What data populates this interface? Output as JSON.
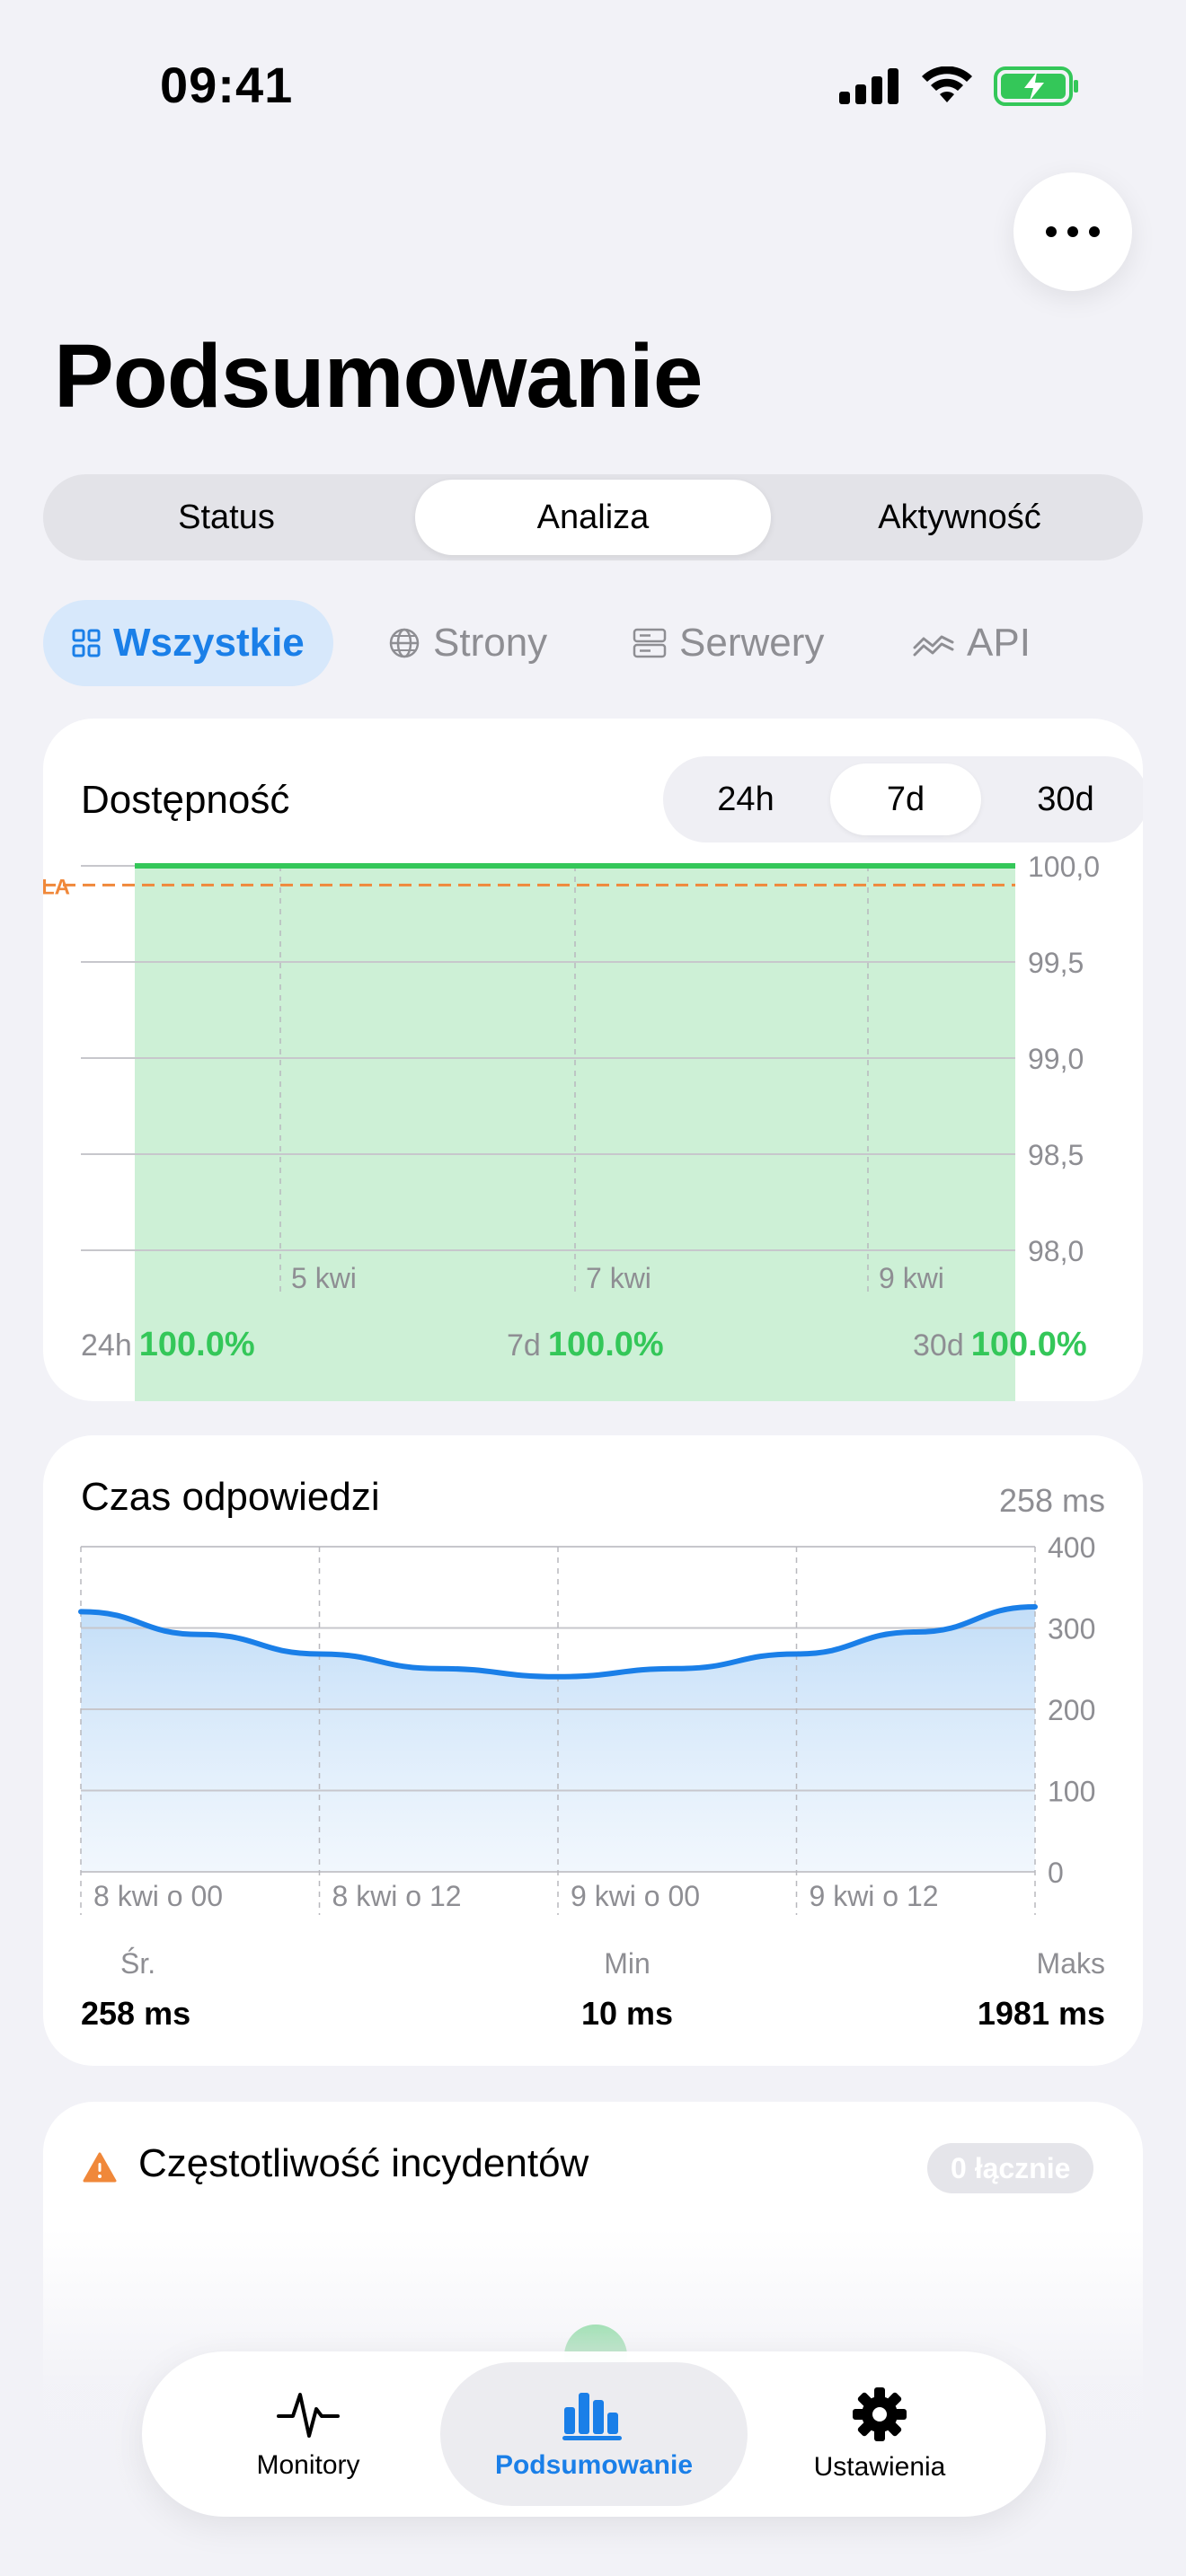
{
  "status_bar": {
    "time": "09:41"
  },
  "header": {
    "title": "Podsumowanie"
  },
  "main_tabs": [
    {
      "label": "Status",
      "active": false
    },
    {
      "label": "Analiza",
      "active": true
    },
    {
      "label": "Aktywność",
      "active": false
    }
  ],
  "filters": [
    {
      "label": "Wszystkie",
      "icon": "grid-icon",
      "active": true
    },
    {
      "label": "Strony",
      "icon": "globe-icon",
      "active": false
    },
    {
      "label": "Serwery",
      "icon": "server-icon",
      "active": false
    },
    {
      "label": "API",
      "icon": "api-wave-icon",
      "active": false
    }
  ],
  "availability": {
    "title": "Dostępność",
    "ranges": [
      {
        "label": "24h",
        "active": false
      },
      {
        "label": "7d",
        "active": true
      },
      {
        "label": "30d",
        "active": false
      }
    ],
    "sla_label": "LA",
    "summary": [
      {
        "label": "24h",
        "value": "100.0%"
      },
      {
        "label": "7d",
        "value": "100.0%"
      },
      {
        "label": "30d",
        "value": "100.0%"
      }
    ]
  },
  "response_time": {
    "title": "Czas odpowiedzi",
    "current": "258 ms",
    "stats": [
      {
        "label": "Śr.",
        "value": "258 ms"
      },
      {
        "label": "Min",
        "value": "10 ms"
      },
      {
        "label": "Maks",
        "value": "1981 ms"
      }
    ]
  },
  "incidents": {
    "title": "Częstotliwość incydentów",
    "badge": "0 łącznie"
  },
  "tabbar": [
    {
      "label": "Monitory",
      "icon": "pulse-icon",
      "active": false
    },
    {
      "label": "Podsumowanie",
      "icon": "bar-chart-icon",
      "active": true
    },
    {
      "label": "Ustawienia",
      "icon": "gear-icon",
      "active": false
    }
  ],
  "colors": {
    "accent": "#1a7fe8",
    "success": "#34c759",
    "sla": "#f0883a",
    "uptime_fill": "#cdf0d6"
  },
  "chart_data": [
    {
      "type": "area",
      "title": "Dostępność",
      "x_tick_labels": [
        "5 kwi",
        "7 kwi",
        "9 kwi"
      ],
      "y_tick_labels": [
        "100,0",
        "99,5",
        "99,0",
        "98,5",
        "98,0"
      ],
      "ylim": [
        98.0,
        100.0
      ],
      "y_ticks": [
        100.0,
        99.5,
        99.0,
        98.5,
        98.0
      ],
      "series": [
        {
          "values": [
            100.0,
            100.0,
            100.0,
            100.0,
            100.0,
            100.0,
            100.0,
            100.0,
            100.0,
            100.0
          ]
        }
      ],
      "sla_value": 99.9
    },
    {
      "type": "area",
      "title": "Czas odpowiedzi",
      "x_tick_labels": [
        "8 kwi o 00",
        "8 kwi o 12",
        "9 kwi o 00",
        "9 kwi o 12"
      ],
      "y_tick_labels": [
        "400",
        "300",
        "200",
        "100",
        "0"
      ],
      "ylim": [
        0,
        400
      ],
      "y_ticks": [
        400,
        300,
        200,
        100,
        0
      ],
      "x_hours": [
        0,
        6,
        12,
        18,
        24,
        30,
        36,
        42,
        48
      ],
      "series": [
        {
          "values": [
            320,
            292,
            268,
            250,
            240,
            250,
            268,
            295,
            326
          ]
        }
      ]
    }
  ]
}
